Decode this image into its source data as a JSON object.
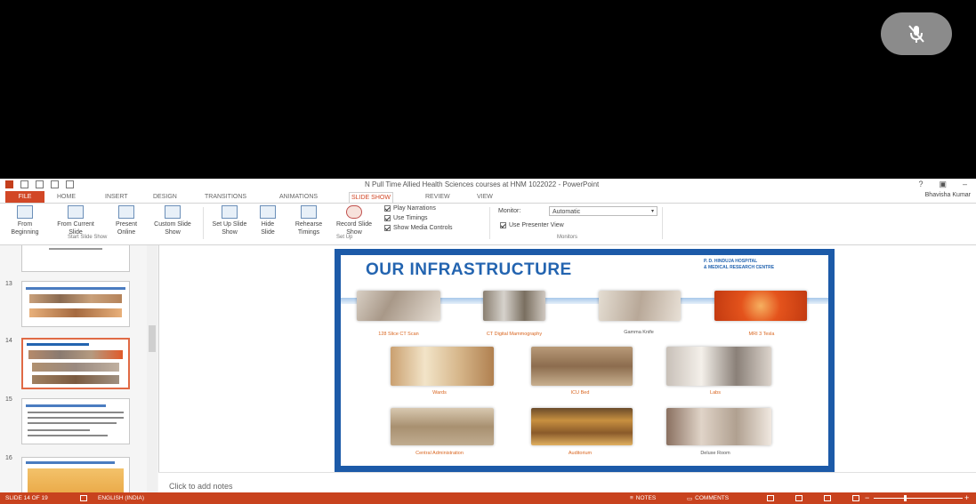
{
  "window": {
    "title": "N Pull Time Allied Health Sciences courses at HNM 1022022 - PowerPoint",
    "user": "Bhavisha Kumar",
    "controls": [
      "?",
      "▣",
      "–"
    ]
  },
  "tabs": {
    "file": "FILE",
    "home": "HOME",
    "insert": "INSERT",
    "design": "DESIGN",
    "transitions": "TRANSITIONS",
    "animations": "ANIMATIONS",
    "slide_show": "SLIDE SHOW",
    "review": "REVIEW",
    "view": "VIEW"
  },
  "ribbon": {
    "from_beginning": "From Beginning",
    "from_current": "From Current Slide",
    "present_online": "Present Online",
    "custom_show": "Custom Slide Show",
    "group_start": "Start Slide Show",
    "set_up": "Set Up Slide Show",
    "hide_slide": "Hide Slide",
    "rehearse": "Rehearse Timings",
    "record": "Record Slide Show",
    "play_narrations": "Play Narrations",
    "use_timings": "Use Timings",
    "show_media": "Show Media Controls",
    "group_setup": "Set Up",
    "monitor_label": "Monitor:",
    "monitor_value": "Automatic",
    "presenter_view": "Use Presenter View",
    "group_monitors": "Monitors"
  },
  "thumbnails": [
    {
      "num": ""
    },
    {
      "num": "13"
    },
    {
      "num": "14"
    },
    {
      "num": "15"
    },
    {
      "num": "16"
    }
  ],
  "slide": {
    "title": "OUR INFRASTRUCTURE",
    "hospital": "P. D. HINDUJA HOSPITAL",
    "hospital_sub": "& MEDICAL RESEARCH CENTRE",
    "captions": [
      "128 Slice CT Scan",
      "CT Digital Mammography",
      "Gamma Knife",
      "MRI 3 Tesla",
      "Wards",
      "ICU Bed",
      "Labs",
      "Central Administration",
      "Auditorium",
      "Deluxe Room"
    ]
  },
  "notes": {
    "placeholder": "Click to add notes"
  },
  "status": {
    "slide_of": "SLIDE 14 OF 19",
    "language": "ENGLISH (INDIA)",
    "notes": "NOTES",
    "comments": "COMMENTS"
  },
  "colors": {
    "accent": "#d24726",
    "statusbar": "#c8421e",
    "slide_border": "#1c5aa8",
    "slide_title": "#2364b0"
  },
  "icons": {
    "mute": "mic-off-icon"
  }
}
